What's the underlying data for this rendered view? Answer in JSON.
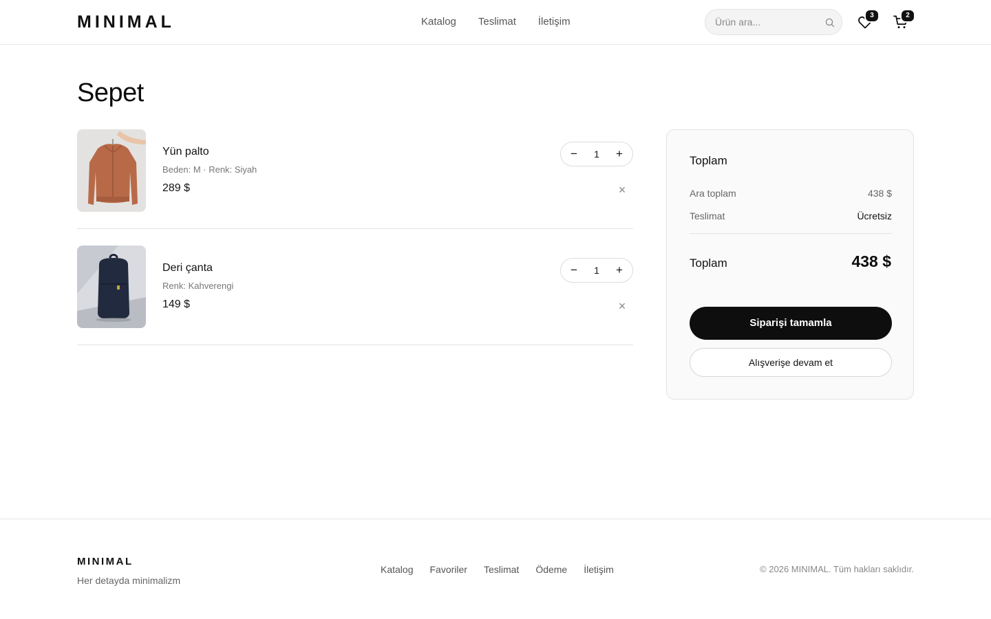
{
  "header": {
    "logo": "MINIMAL",
    "nav": [
      "Katalog",
      "Teslimat",
      "İletişim"
    ],
    "search_placeholder": "Ürün ara...",
    "favorites_count": "3",
    "cart_count": "2"
  },
  "page_title": "Sepet",
  "cart_items": [
    {
      "name": "Yün palto",
      "meta": "Beden: M · Renk: Siyah",
      "price": "289 $",
      "qty": "1",
      "image": "orange-jacket-photo"
    },
    {
      "name": "Deri çanta",
      "meta": "Renk: Kahverengi",
      "price": "149 $",
      "qty": "1",
      "image": "navy-backpack-photo"
    }
  ],
  "stepper": {
    "minus": "−",
    "plus": "+"
  },
  "remove_symbol": "×",
  "summary": {
    "title": "Toplam",
    "subtotal_label": "Ara toplam",
    "subtotal_value": "438 $",
    "shipping_label": "Teslimat",
    "shipping_value": "Ücretsiz",
    "total_label": "Toplam",
    "total_value": "438 $",
    "checkout_button": "Siparişi tamamla",
    "continue_button": "Alışverişe devam et"
  },
  "footer": {
    "logo": "MINIMAL",
    "tagline": "Her detayda minimalizm",
    "links": [
      "Katalog",
      "Favoriler",
      "Teslimat",
      "Ödeme",
      "İletişim"
    ],
    "copyright": "© 2026 MINIMAL. Tüm hakları saklıdır."
  },
  "colors": {
    "primary": "#0e0e0e",
    "muted": "#777777",
    "border": "#e3e3e3",
    "panel_bg": "#fafafa"
  }
}
